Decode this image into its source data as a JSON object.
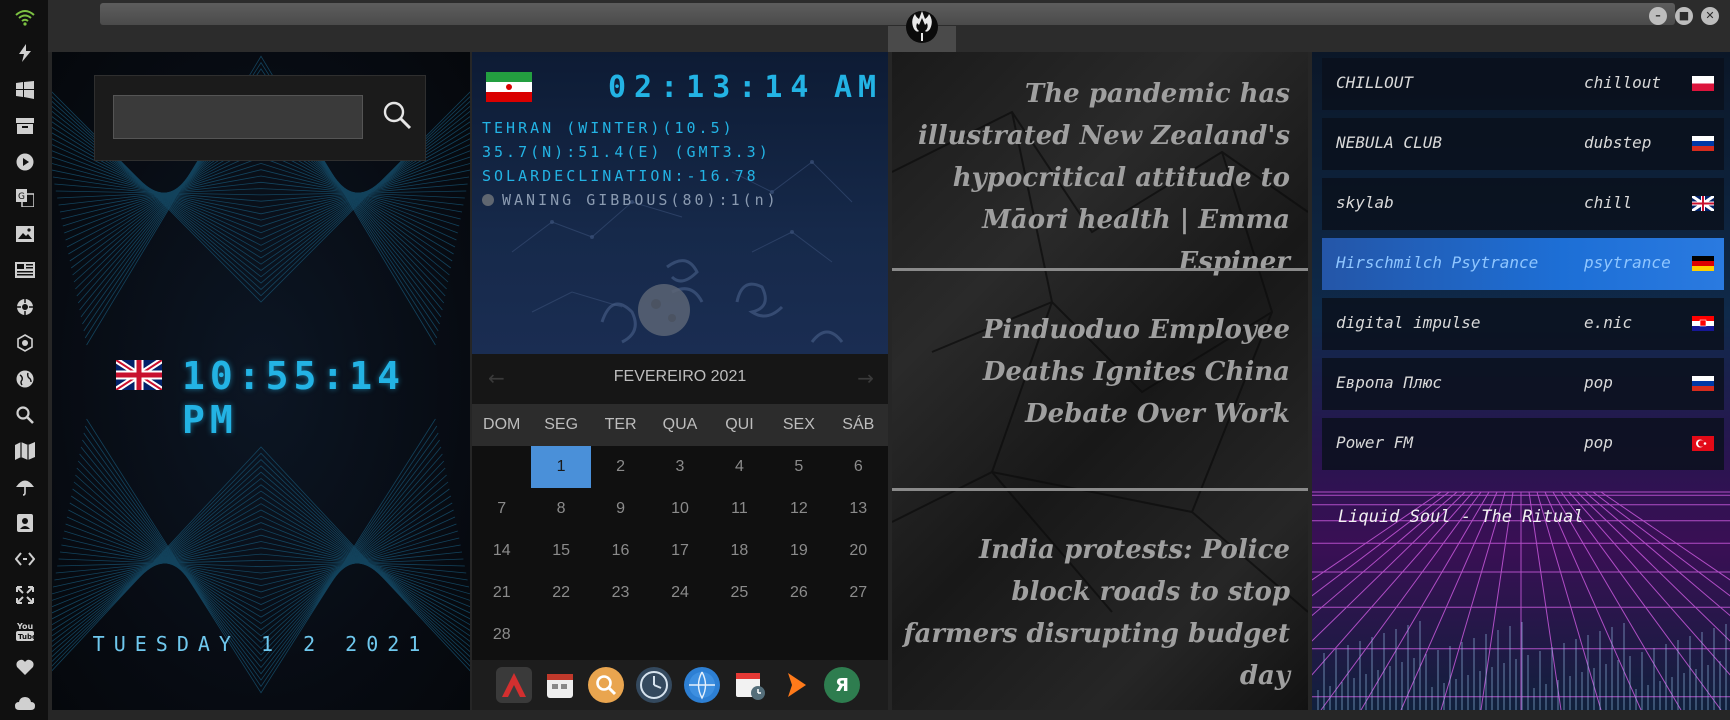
{
  "left_bar": {
    "icons": [
      "wifi-icon",
      "bolt-icon",
      "windows-icon",
      "archive-icon",
      "play-icon",
      "translate-icon",
      "image-icon",
      "newspaper-icon",
      "settings-cog-icon",
      "hexagon-icon",
      "globe-icon",
      "search-icon",
      "map-icon",
      "umbrella-icon",
      "contacts-icon",
      "code-icon",
      "expand-icon",
      "youtube-icon",
      "heart-icon",
      "cloud-icon"
    ],
    "accent": "#7cc242"
  },
  "window": {
    "controls": [
      "–",
      "■",
      "✕"
    ]
  },
  "clock_uk": {
    "search_placeholder": "",
    "time": "10:55:14 PM",
    "date": "TUESDAY 1 2 2021",
    "flag": "united-kingdom"
  },
  "clock_tehran": {
    "time": "02:13:14",
    "ampm": "AM",
    "line1": "TEHRAN (WINTER)(10.5)",
    "line2": "35.7(N):51.4(E) (GMT3.3)",
    "line3": "SOLARDECLINATION:-16.78",
    "moon": "WANING GIBBOUS(80):1(n)",
    "flag": "iran"
  },
  "calendar": {
    "title": "FEVEREIRO 2021",
    "prev": "←",
    "next": "→",
    "weekdays": [
      "DOM",
      "SEG",
      "TER",
      "QUA",
      "QUI",
      "SEX",
      "SÁB"
    ],
    "days": [
      "",
      "1",
      "2",
      "3",
      "4",
      "5",
      "6",
      "7",
      "8",
      "9",
      "10",
      "11",
      "12",
      "13",
      "14",
      "15",
      "16",
      "17",
      "18",
      "19",
      "20",
      "21",
      "22",
      "23",
      "24",
      "25",
      "26",
      "27",
      "28"
    ],
    "today": "1"
  },
  "dock": {
    "icons": [
      "launcher-icon",
      "calendar-app-icon",
      "search-app-icon",
      "clock-app-icon",
      "browser-globe-icon",
      "schedule-icon",
      "arrow-app-icon",
      "yandex-icon"
    ],
    "yandex_label": "Я"
  },
  "news": [
    "The pandemic has illustrated New Zealand's hypocritical attitude to Māori health | Emma Espiner",
    "Pinduoduo Employee Deaths Ignites China Debate Over Work",
    "India protests: Police block roads to stop farmers disrupting budget day"
  ],
  "radio": {
    "stations": [
      {
        "name": "CHILLOUT",
        "genre": "chillout",
        "flag": "poland"
      },
      {
        "name": "NEBULA CLUB",
        "genre": "dubstep",
        "flag": "russia"
      },
      {
        "name": "skylab",
        "genre": "chill",
        "flag": "united-kingdom"
      },
      {
        "name": "Hirschmilch Psytrance",
        "genre": "psytrance",
        "flag": "germany"
      },
      {
        "name": "digital impulse",
        "genre": "e.nic",
        "flag": "croatia"
      },
      {
        "name": "Европа Плюс",
        "genre": "pop",
        "flag": "russia"
      },
      {
        "name": "Power FM",
        "genre": "pop",
        "flag": "turkey"
      }
    ],
    "active": "Hirschmilch Psytrance",
    "now_playing": "Liquid Soul - The Ritual"
  }
}
